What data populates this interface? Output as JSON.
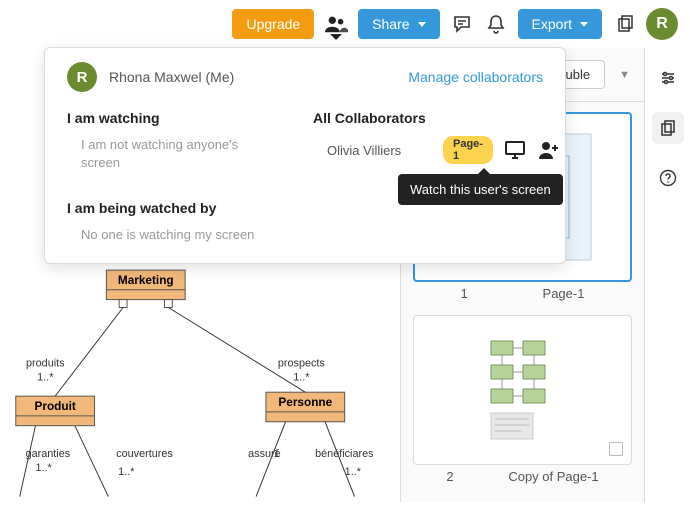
{
  "topbar": {
    "upgrade": "Upgrade",
    "share": "Share",
    "export": "Export",
    "avatar_initial": "R"
  },
  "popover": {
    "me_initial": "R",
    "me_name": "Rhona Maxwel (Me)",
    "manage": "Manage collaborators",
    "watching_heading": "I am watching",
    "watching_status": "I am not watching anyone's screen",
    "watched_by_heading": "I am being watched by",
    "watched_by_status": "No one is watching my screen",
    "all_heading": "All Collaborators",
    "collaborator": {
      "name": "Olivia Villiers",
      "page_badge": "Page-1"
    },
    "tooltip": "Watch this user's screen"
  },
  "rightpane": {
    "double_btn": "Double",
    "pages": [
      {
        "index": "1",
        "label": "Page-1",
        "selected": true,
        "thumb": "preview1"
      },
      {
        "index": "2",
        "label": "Copy of Page-1",
        "selected": false,
        "thumb": "preview2"
      }
    ]
  },
  "diagram": {
    "nodes": {
      "marketing": "Marketing",
      "produit": "Produit",
      "personne": "Personne"
    },
    "edges": {
      "produits": {
        "label": "produits",
        "mult": "1..*"
      },
      "prospects": {
        "label": "prospects",
        "mult": "1..*"
      },
      "garanties": {
        "label": "garanties",
        "mult": "1..*"
      },
      "couvertures": {
        "label": "couvertures",
        "mult": "1..*"
      },
      "assure": {
        "label": "assuré",
        "mult": "1"
      },
      "beneficiaires": {
        "label": "bénéficiares",
        "mult": "1..*"
      }
    }
  }
}
